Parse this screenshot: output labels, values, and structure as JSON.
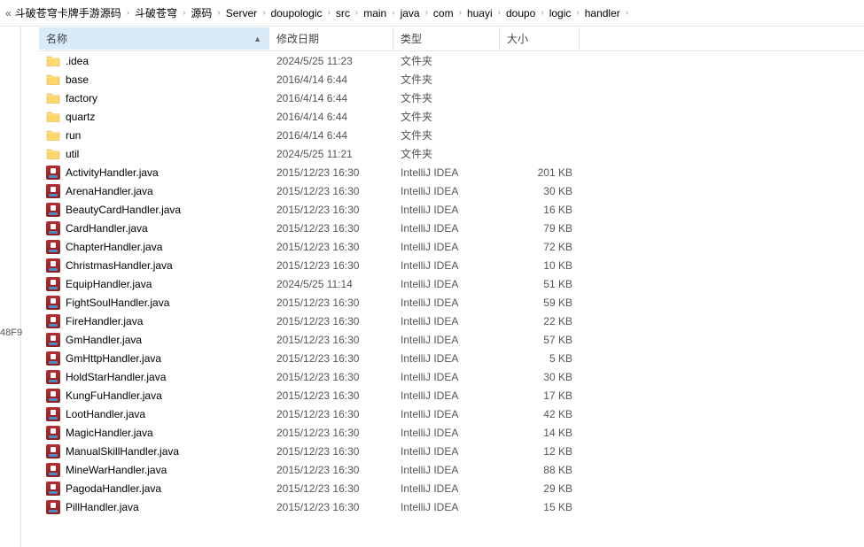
{
  "breadcrumb": {
    "prefix": "«",
    "items": [
      "斗破苍穹卡牌手游源码",
      "斗破苍穹",
      "源码",
      "Server",
      "doupologic",
      "src",
      "main",
      "java",
      "com",
      "huayi",
      "doupo",
      "logic",
      "handler"
    ]
  },
  "nav_fragment": "48F9",
  "columns": {
    "name": "名称",
    "date": "修改日期",
    "type": "类型",
    "size": "大小"
  },
  "rows": [
    {
      "icon": "folder",
      "name": ".idea",
      "date": "2024/5/25 11:23",
      "type": "文件夹",
      "size": ""
    },
    {
      "icon": "folder",
      "name": "base",
      "date": "2016/4/14 6:44",
      "type": "文件夹",
      "size": ""
    },
    {
      "icon": "folder",
      "name": "factory",
      "date": "2016/4/14 6:44",
      "type": "文件夹",
      "size": ""
    },
    {
      "icon": "folder",
      "name": "quartz",
      "date": "2016/4/14 6:44",
      "type": "文件夹",
      "size": ""
    },
    {
      "icon": "folder",
      "name": "run",
      "date": "2016/4/14 6:44",
      "type": "文件夹",
      "size": ""
    },
    {
      "icon": "folder",
      "name": "util",
      "date": "2024/5/25 11:21",
      "type": "文件夹",
      "size": ""
    },
    {
      "icon": "java",
      "name": "ActivityHandler.java",
      "date": "2015/12/23 16:30",
      "type": "IntelliJ IDEA",
      "size": "201 KB"
    },
    {
      "icon": "java",
      "name": "ArenaHandler.java",
      "date": "2015/12/23 16:30",
      "type": "IntelliJ IDEA",
      "size": "30 KB"
    },
    {
      "icon": "java",
      "name": "BeautyCardHandler.java",
      "date": "2015/12/23 16:30",
      "type": "IntelliJ IDEA",
      "size": "16 KB"
    },
    {
      "icon": "java",
      "name": "CardHandler.java",
      "date": "2015/12/23 16:30",
      "type": "IntelliJ IDEA",
      "size": "79 KB"
    },
    {
      "icon": "java",
      "name": "ChapterHandler.java",
      "date": "2015/12/23 16:30",
      "type": "IntelliJ IDEA",
      "size": "72 KB"
    },
    {
      "icon": "java",
      "name": "ChristmasHandler.java",
      "date": "2015/12/23 16:30",
      "type": "IntelliJ IDEA",
      "size": "10 KB"
    },
    {
      "icon": "java",
      "name": "EquipHandler.java",
      "date": "2024/5/25 11:14",
      "type": "IntelliJ IDEA",
      "size": "51 KB"
    },
    {
      "icon": "java",
      "name": "FightSoulHandler.java",
      "date": "2015/12/23 16:30",
      "type": "IntelliJ IDEA",
      "size": "59 KB"
    },
    {
      "icon": "java",
      "name": "FireHandler.java",
      "date": "2015/12/23 16:30",
      "type": "IntelliJ IDEA",
      "size": "22 KB"
    },
    {
      "icon": "java",
      "name": "GmHandler.java",
      "date": "2015/12/23 16:30",
      "type": "IntelliJ IDEA",
      "size": "57 KB"
    },
    {
      "icon": "java",
      "name": "GmHttpHandler.java",
      "date": "2015/12/23 16:30",
      "type": "IntelliJ IDEA",
      "size": "5 KB"
    },
    {
      "icon": "java",
      "name": "HoldStarHandler.java",
      "date": "2015/12/23 16:30",
      "type": "IntelliJ IDEA",
      "size": "30 KB"
    },
    {
      "icon": "java",
      "name": "KungFuHandler.java",
      "date": "2015/12/23 16:30",
      "type": "IntelliJ IDEA",
      "size": "17 KB"
    },
    {
      "icon": "java",
      "name": "LootHandler.java",
      "date": "2015/12/23 16:30",
      "type": "IntelliJ IDEA",
      "size": "42 KB"
    },
    {
      "icon": "java",
      "name": "MagicHandler.java",
      "date": "2015/12/23 16:30",
      "type": "IntelliJ IDEA",
      "size": "14 KB"
    },
    {
      "icon": "java",
      "name": "ManualSkillHandler.java",
      "date": "2015/12/23 16:30",
      "type": "IntelliJ IDEA",
      "size": "12 KB"
    },
    {
      "icon": "java",
      "name": "MineWarHandler.java",
      "date": "2015/12/23 16:30",
      "type": "IntelliJ IDEA",
      "size": "88 KB"
    },
    {
      "icon": "java",
      "name": "PagodaHandler.java",
      "date": "2015/12/23 16:30",
      "type": "IntelliJ IDEA",
      "size": "29 KB"
    },
    {
      "icon": "java",
      "name": "PillHandler.java",
      "date": "2015/12/23 16:30",
      "type": "IntelliJ IDEA",
      "size": "15 KB"
    }
  ]
}
